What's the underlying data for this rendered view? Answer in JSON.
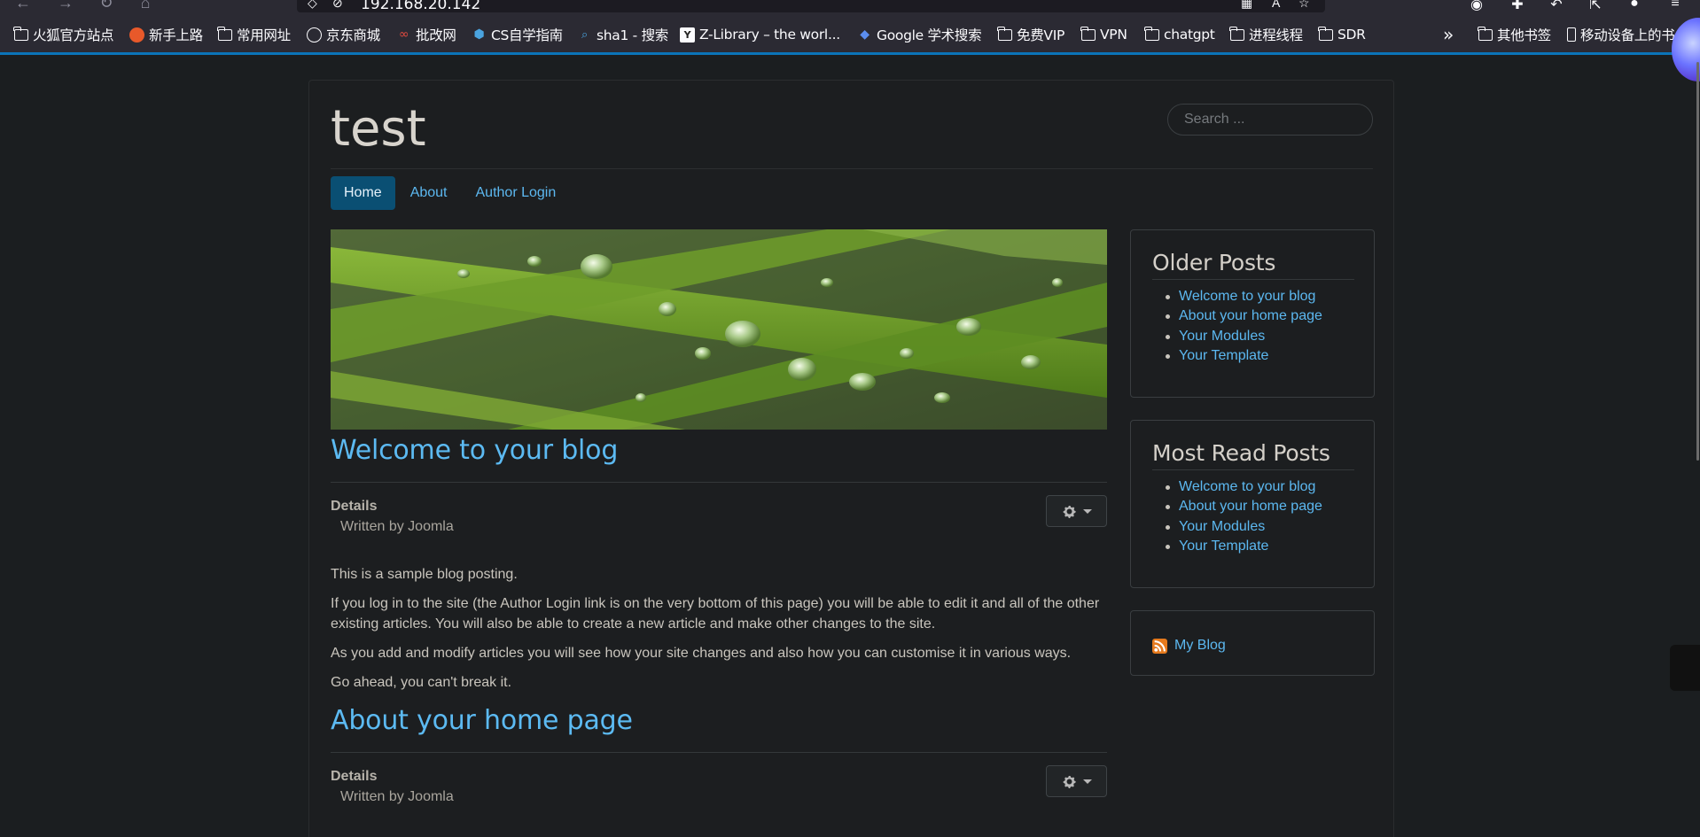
{
  "browser": {
    "url": "192.168.20.142",
    "bookmarks": [
      {
        "label": "火狐官方站点",
        "icon": "folder-icon"
      },
      {
        "label": "新手上路",
        "icon": "firefox-icon"
      },
      {
        "label": "常用网址",
        "icon": "folder-icon"
      },
      {
        "label": "京东商城",
        "icon": "globe-icon"
      },
      {
        "label": "批改网",
        "icon": "pigai-icon"
      },
      {
        "label": "CS自学指南",
        "icon": "cs-guide-icon"
      },
      {
        "label": "sha1 - 搜索",
        "icon": "search-icon"
      },
      {
        "label": "Z-Library – the worl...",
        "icon": "zlibrary-icon"
      },
      {
        "label": "Google 学术搜索",
        "icon": "scholar-icon"
      },
      {
        "label": "免费VIP",
        "icon": "folder-icon"
      },
      {
        "label": "VPN",
        "icon": "folder-icon"
      },
      {
        "label": "chatgpt",
        "icon": "folder-icon"
      },
      {
        "label": "进程线程",
        "icon": "folder-icon"
      },
      {
        "label": "SDR",
        "icon": "folder-icon"
      },
      {
        "label": "其他书签",
        "icon": "folder-icon"
      },
      {
        "label": "移动设备上的书",
        "icon": "mobile-icon"
      }
    ]
  },
  "site": {
    "title": "test",
    "search_placeholder": "Search ...",
    "nav": [
      "Home",
      "About",
      "Author Login"
    ]
  },
  "posts": [
    {
      "title": "Welcome to your blog",
      "details_label": "Details",
      "author": "Written by Joomla",
      "paragraphs": [
        "This is a sample blog posting.",
        "If you log in to the site (the Author Login link is on the very bottom of this page) you will be able to edit it and all of the other existing articles. You will also be able to create a new article and make other changes to the site.",
        "As you add and modify articles you will see how your site changes and also how you can customise it in various ways.",
        "Go ahead, you can't break it."
      ]
    },
    {
      "title": "About your home page",
      "details_label": "Details",
      "author": "Written by Joomla"
    }
  ],
  "sidebar": {
    "older_posts": {
      "title": "Older Posts",
      "items": [
        "Welcome to your blog",
        "About your home page",
        "Your Modules",
        "Your Template"
      ]
    },
    "most_read": {
      "title": "Most Read Posts",
      "items": [
        "Welcome to your blog",
        "About your home page",
        "Your Modules",
        "Your Template"
      ]
    },
    "feed": {
      "label": "My Blog"
    }
  },
  "colors": {
    "link": "#5cb8f0",
    "nav_active": "#0a4f73",
    "page_bg": "#1b1e20"
  }
}
